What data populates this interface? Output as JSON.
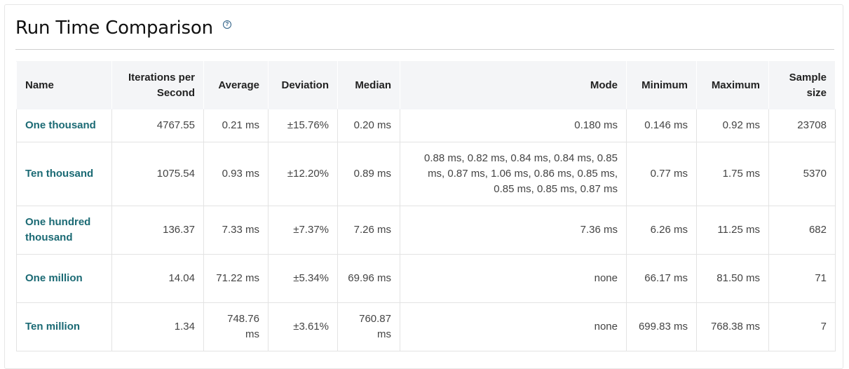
{
  "title": "Run Time Comparison",
  "help_icon": "question-circle-icon",
  "colors": {
    "name_link": "#1b6a74",
    "header_bg": "#f4f5f7",
    "help_icon": "#2a5d84"
  },
  "table": {
    "columns": [
      "Name",
      "Iterations per Second",
      "Average",
      "Deviation",
      "Median",
      "Mode",
      "Minimum",
      "Maximum",
      "Sample size"
    ],
    "rows": [
      [
        "One thousand",
        "4767.55",
        "0.21 ms",
        "±15.76%",
        "0.20 ms",
        "0.180 ms",
        "0.146 ms",
        "0.92 ms",
        "23708"
      ],
      [
        "Ten thousand",
        "1075.54",
        "0.93 ms",
        "±12.20%",
        "0.89 ms",
        "0.88 ms, 0.82 ms, 0.84 ms, 0.84 ms, 0.85 ms, 0.87 ms, 1.06 ms, 0.86 ms, 0.85 ms, 0.85 ms, 0.85 ms, 0.87 ms",
        "0.77 ms",
        "1.75 ms",
        "5370"
      ],
      [
        "One hundred thousand",
        "136.37",
        "7.33 ms",
        "±7.37%",
        "7.26 ms",
        "7.36 ms",
        "6.26 ms",
        "11.25 ms",
        "682"
      ],
      [
        "One million",
        "14.04",
        "71.22 ms",
        "±5.34%",
        "69.96 ms",
        "none",
        "66.17 ms",
        "81.50 ms",
        "71"
      ],
      [
        "Ten million",
        "1.34",
        "748.76 ms",
        "±3.61%",
        "760.87 ms",
        "none",
        "699.83 ms",
        "768.38 ms",
        "7"
      ]
    ]
  }
}
